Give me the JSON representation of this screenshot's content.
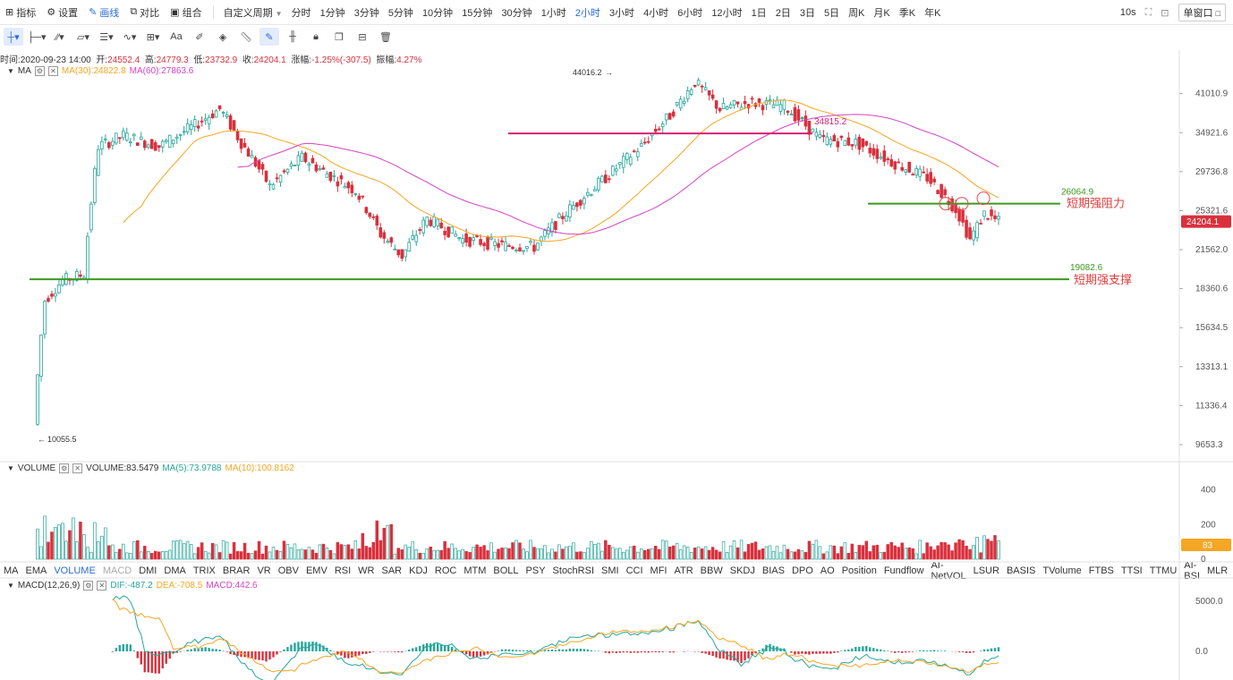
{
  "toolbar": {
    "indicator_label": "指标",
    "settings_label": "设置",
    "draw_label": "画线",
    "compare_label": "对比",
    "combo_label": "组合",
    "custom_period_label": "自定义周期",
    "periods": [
      "分时",
      "1分钟",
      "3分钟",
      "5分钟",
      "10分钟",
      "15分钟",
      "30分钟",
      "1小时",
      "2小时",
      "3小时",
      "4小时",
      "6小时",
      "12小时",
      "1日",
      "2日",
      "3日",
      "5日",
      "周K",
      "月K",
      "季K",
      "年K"
    ],
    "active_period": "2小时",
    "refresh": "10s",
    "window_mode": "单窗口"
  },
  "info": {
    "time_label": "时间:",
    "time": "2020-09-23 14:00",
    "open_label": "开:",
    "open": "24552.4",
    "high_label": "高:",
    "high": "24779.3",
    "low_label": "低:",
    "low": "23732.9",
    "close_label": "收:",
    "close": "24204.1",
    "change_label": "涨幅:",
    "change": "-1.25%(-307.5)",
    "amp_label": "振幅:",
    "amp": "4.27%"
  },
  "ma_legend": {
    "name": "MA",
    "ma30": "MA(30):24822.8",
    "ma60": "MA(60):27863.6"
  },
  "volume_legend": {
    "name": "VOLUME",
    "value": "VOLUME:83.5479",
    "ma5": "MA(5):73.9788",
    "ma10": "MA(10):100.8162"
  },
  "macd_legend": {
    "name": "MACD(12,26,9)",
    "dif": "DIF:-487.2",
    "dea": "DEA:-708.5",
    "macd": "MACD:442.6"
  },
  "indicator_tabs": [
    "MA",
    "EMA",
    "VOLUME",
    "MACD",
    "DMI",
    "DMA",
    "TRIX",
    "BRAR",
    "VR",
    "OBV",
    "EMV",
    "RSI",
    "WR",
    "SAR",
    "KDJ",
    "ROC",
    "MTM",
    "BOLL",
    "PSY",
    "StochRSI",
    "SMI",
    "CCI",
    "MFI",
    "ATR",
    "BBW",
    "SKDJ",
    "BIAS",
    "DPO",
    "AO",
    "Position",
    "Fundflow",
    "AI-NetVOL",
    "LSUR",
    "BASIS",
    "TVolume",
    "FTBS",
    "TTSI",
    "TTMU",
    "AI-BSI",
    "MLR"
  ],
  "active_indicator": "VOLUME",
  "muted_indicator": "MACD",
  "price_axis": [
    "41010.9",
    "34921.6",
    "29736.8",
    "25321.6",
    "21562.0",
    "18360.6",
    "15634.5",
    "13313.1",
    "11336.4",
    "9653.3"
  ],
  "current_price": "24204.1",
  "volume_axis": [
    "400",
    "200",
    "0"
  ],
  "volume_current": "83",
  "macd_axis": [
    "5000.0",
    "0.0"
  ],
  "annotations": {
    "high_mark": "44016.2",
    "low_mark": "10055.5",
    "mid_line_value": "34815.2",
    "resistance_value": "26064.9",
    "resistance_label": "短期强阻力",
    "support_value": "19082.6",
    "support_label": "短期强支撑"
  },
  "colors": {
    "up": "#26a69a",
    "down": "#d9303c",
    "ma30": "#f5a623",
    "ma60": "#d444c4",
    "trendline": "#3a9a1e",
    "pinkline": "#d61f7a",
    "accent": "#2b6bd6"
  }
}
